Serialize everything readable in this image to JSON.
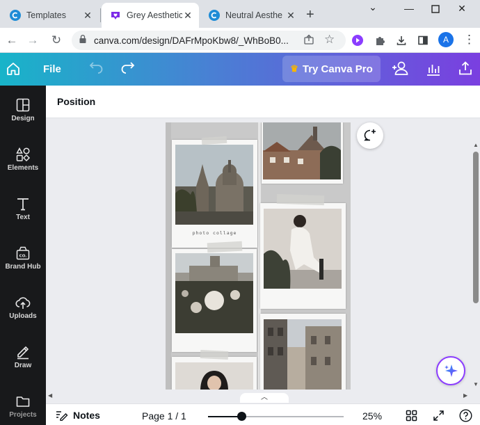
{
  "browser": {
    "tabs": [
      {
        "title": "Templates",
        "active": false
      },
      {
        "title": "Grey Aesthetic",
        "active": true
      },
      {
        "title": "Neutral Aesthe",
        "active": false
      }
    ],
    "url": "canva.com/design/DAFrMpoKbw8/_WhBoB0...",
    "avatar_letter": "A",
    "colors": {
      "canva_gradient_start": "#18b4c9",
      "canva_gradient_end": "#7a3fe0",
      "profile": "#1a73e8",
      "active_extension": "#8b3dff"
    }
  },
  "header": {
    "file_label": "File",
    "try_pro_label": "Try Canva Pro"
  },
  "sidebar": {
    "items": [
      {
        "label": "Design",
        "icon": "layout-icon"
      },
      {
        "label": "Elements",
        "icon": "shapes-icon"
      },
      {
        "label": "Text",
        "icon": "text-icon"
      },
      {
        "label": "Brand Hub",
        "icon": "brand-hub-icon"
      },
      {
        "label": "Uploads",
        "icon": "cloud-upload-icon"
      },
      {
        "label": "Draw",
        "icon": "pen-icon"
      },
      {
        "label": "Projects",
        "icon": "folder-icon"
      }
    ]
  },
  "editor": {
    "context_label": "Position",
    "collage_caption": "photo collage"
  },
  "bottom": {
    "notes_label": "Notes",
    "page_label": "Page 1 / 1",
    "zoom_label": "25%",
    "zoom_fraction": 0.25
  }
}
